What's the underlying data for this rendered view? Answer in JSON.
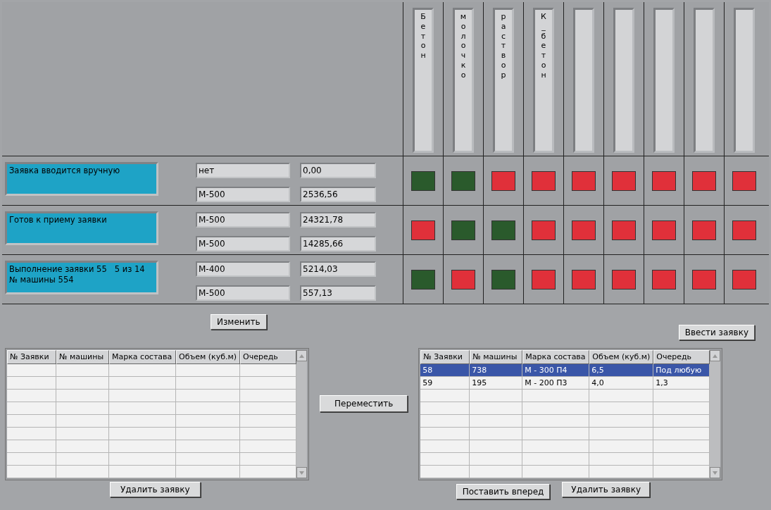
{
  "bins": [
    {
      "kind": "labeled",
      "label": "Бетон"
    },
    {
      "kind": "labeled",
      "label": "молочко"
    },
    {
      "kind": "labeled",
      "label": "раствор"
    },
    {
      "kind": "labeled",
      "label": "К_бетон"
    },
    {
      "kind": "blank"
    },
    {
      "kind": "blank"
    },
    {
      "kind": "blank"
    },
    {
      "kind": "blank"
    },
    {
      "kind": "blank"
    }
  ],
  "lines": [
    {
      "status": "Заявка вводится вручную",
      "fields": [
        [
          "нет",
          "0,00"
        ],
        [
          "М-500",
          "2536,56"
        ]
      ],
      "lamps": [
        {
          "color": "#2a5a2c"
        },
        {
          "color": "#2a5a2c"
        },
        {
          "color": "#e0303a"
        },
        {
          "color": "#e0303a"
        },
        {
          "color": "#e0303a"
        },
        {
          "color": "#e0303a"
        },
        {
          "color": "#e0303a"
        },
        {
          "color": "#e0303a"
        },
        {
          "color": "#e0303a"
        }
      ]
    },
    {
      "status": "Готов к приему заявки",
      "fields": [
        [
          "М-500",
          "24321,78"
        ],
        [
          "М-500",
          "14285,66"
        ]
      ],
      "lamps": [
        {
          "color": "#e0303a"
        },
        {
          "color": "#2a5a2c"
        },
        {
          "color": "#2a5a2c"
        },
        {
          "color": "#e0303a"
        },
        {
          "color": "#e0303a"
        },
        {
          "color": "#e0303a"
        },
        {
          "color": "#e0303a"
        },
        {
          "color": "#e0303a"
        },
        {
          "color": "#e0303a"
        }
      ]
    },
    {
      "status": "Выполнение заявки 55   5 из 14\n№ машины 554",
      "fields": [
        [
          "М-400",
          "5214,03"
        ],
        [
          "М-500",
          "557,13"
        ]
      ],
      "lamps": [
        {
          "color": "#2a5a2c"
        },
        {
          "color": "#e0303a"
        },
        {
          "color": "#2a5a2c"
        },
        {
          "color": "#e0303a"
        },
        {
          "color": "#e0303a"
        },
        {
          "color": "#e0303a"
        },
        {
          "color": "#e0303a"
        },
        {
          "color": "#e0303a"
        },
        {
          "color": "#e0303a"
        }
      ]
    }
  ],
  "change_button": "Изменить",
  "enter_button": "Ввести заявку",
  "move_button": "Переместить",
  "left_table": {
    "columns": [
      "№ Заявки",
      "№ машины",
      "Марка состава",
      "Объем (куб.м)",
      "Очередь"
    ]
  },
  "left_delete_button": "Удалить заявку",
  "right_table": {
    "columns": [
      "№ Заявки",
      "№ машины",
      "Марка состава",
      "Объем (куб.м)",
      "Очередь"
    ],
    "rows": [
      {
        "selected": true,
        "cells": [
          "58",
          "738",
          "М - 300 П4",
          "6,5",
          "Под любую"
        ]
      },
      {
        "selected": false,
        "cells": [
          "59",
          "195",
          "М - 200 П3",
          "4,0",
          "1,3"
        ]
      }
    ]
  },
  "forward_button": "Поставить вперед",
  "right_delete_button": "Удалить заявку"
}
